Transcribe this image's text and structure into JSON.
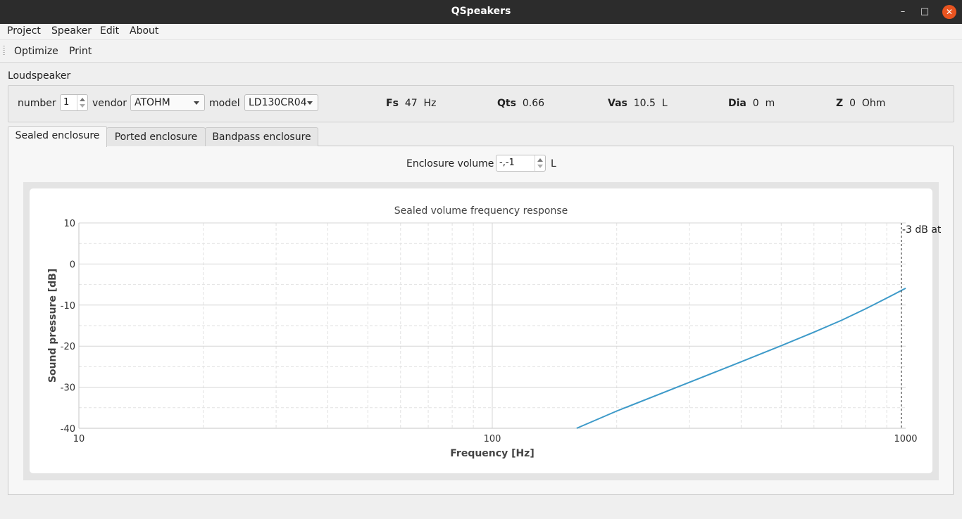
{
  "window": {
    "title": "QSpeakers"
  },
  "menu": {
    "project": "Project",
    "speaker": "Speaker",
    "edit": "Edit",
    "about": "About"
  },
  "toolbar": {
    "optimize": "Optimize",
    "print": "Print"
  },
  "loudspeaker": {
    "group_label": "Loudspeaker",
    "number_label": "number",
    "number_value": "1",
    "vendor_label": "vendor",
    "vendor_value": "ATOHM",
    "model_label": "model",
    "model_value": "LD130CR04",
    "params": [
      {
        "name": "Fs",
        "value": "47",
        "unit": "Hz"
      },
      {
        "name": "Qts",
        "value": "0.66",
        "unit": ""
      },
      {
        "name": "Vas",
        "value": "10.5",
        "unit": "L"
      },
      {
        "name": "Dia",
        "value": "0",
        "unit": "m"
      },
      {
        "name": "Z",
        "value": "0",
        "unit": "Ohm"
      }
    ]
  },
  "tabs": {
    "sealed": "Sealed enclosure",
    "ported": "Ported enclosure",
    "bandpass": "Bandpass enclosure"
  },
  "enclosure": {
    "label": "Enclosure volume",
    "value": "-,-1",
    "unit": "L"
  },
  "colors": {
    "curve": "#3d9ac9",
    "titlebar": "#2c2c2c",
    "close": "#e95420"
  },
  "chart_data": {
    "type": "line",
    "title": "Sealed volume frequency response",
    "xlabel": "Frequency [Hz]",
    "ylabel": "Sound pressure [dB]",
    "xscale": "log",
    "xlim": [
      10,
      1000
    ],
    "ylim": [
      -40,
      10
    ],
    "xticks": [
      10,
      100,
      1000
    ],
    "yticks": [
      10,
      0,
      -10,
      -20,
      -30,
      -40
    ],
    "grid": true,
    "series": [
      {
        "x": [
          160,
          200,
          300,
          400,
          500,
          600,
          700,
          800,
          900,
          1000
        ],
        "y": [
          -40.0,
          -35.8,
          -28.8,
          -23.8,
          -19.9,
          -16.6,
          -13.7,
          -10.9,
          -8.3,
          -5.9
        ]
      }
    ],
    "annotation": {
      "text": "-3 dB at",
      "x": 1000
    }
  }
}
